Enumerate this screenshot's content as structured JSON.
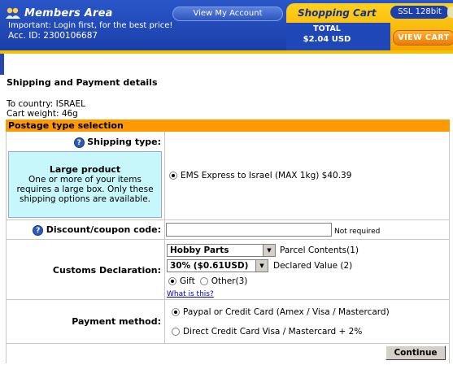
{
  "header": {
    "members_title": "Members Area",
    "view_account": "View My Account",
    "important": "Important: Login first, for the best price!",
    "acc_id": "Acc. ID: 2300106687",
    "shopping_cart": "Shopping Cart",
    "ssl": "SSL 128bit",
    "total_label": "TOTAL",
    "total_value": "$2.04 USD",
    "view_cart": "VIEW CART",
    "colors": {
      "header_blue": "#1f47b8",
      "cart_yellow": "#ffd21c",
      "view_cart_orange": "#ee7a00"
    }
  },
  "page": {
    "title": "Shipping and Payment details",
    "to_country": "To country: ISRAEL",
    "cart_weight": "Cart weight: 46g"
  },
  "postage": {
    "header": "Postage type selection",
    "header_color": "#ff9900",
    "shipping_type_label": "Shipping type:",
    "large_product_title": "Large product",
    "large_product_desc": "One or more of your items requires a large box. Only these shipping options are available.",
    "ems_option": "EMS Express to Israel (MAX 1kg) $40.39",
    "discount_label": "Discount/coupon code:",
    "discount_value": "",
    "not_required": "Not required",
    "customs_label": "Customs Declaration:",
    "contents_selected": "Hobby Parts",
    "contents_note": "Parcel Contents(1)",
    "value_selected": "30% ($0.61USD)",
    "value_note": "Declared Value (2)",
    "gift_label": "Gift",
    "other_label": "Other(3)",
    "what_is_this": "What is this?",
    "payment_label": "Payment method:",
    "payment_options": [
      "Paypal or Credit Card (Amex / Visa / Mastercard)",
      "Direct Credit Card Visa / Mastercard + 2%"
    ],
    "continue": "Continue"
  }
}
